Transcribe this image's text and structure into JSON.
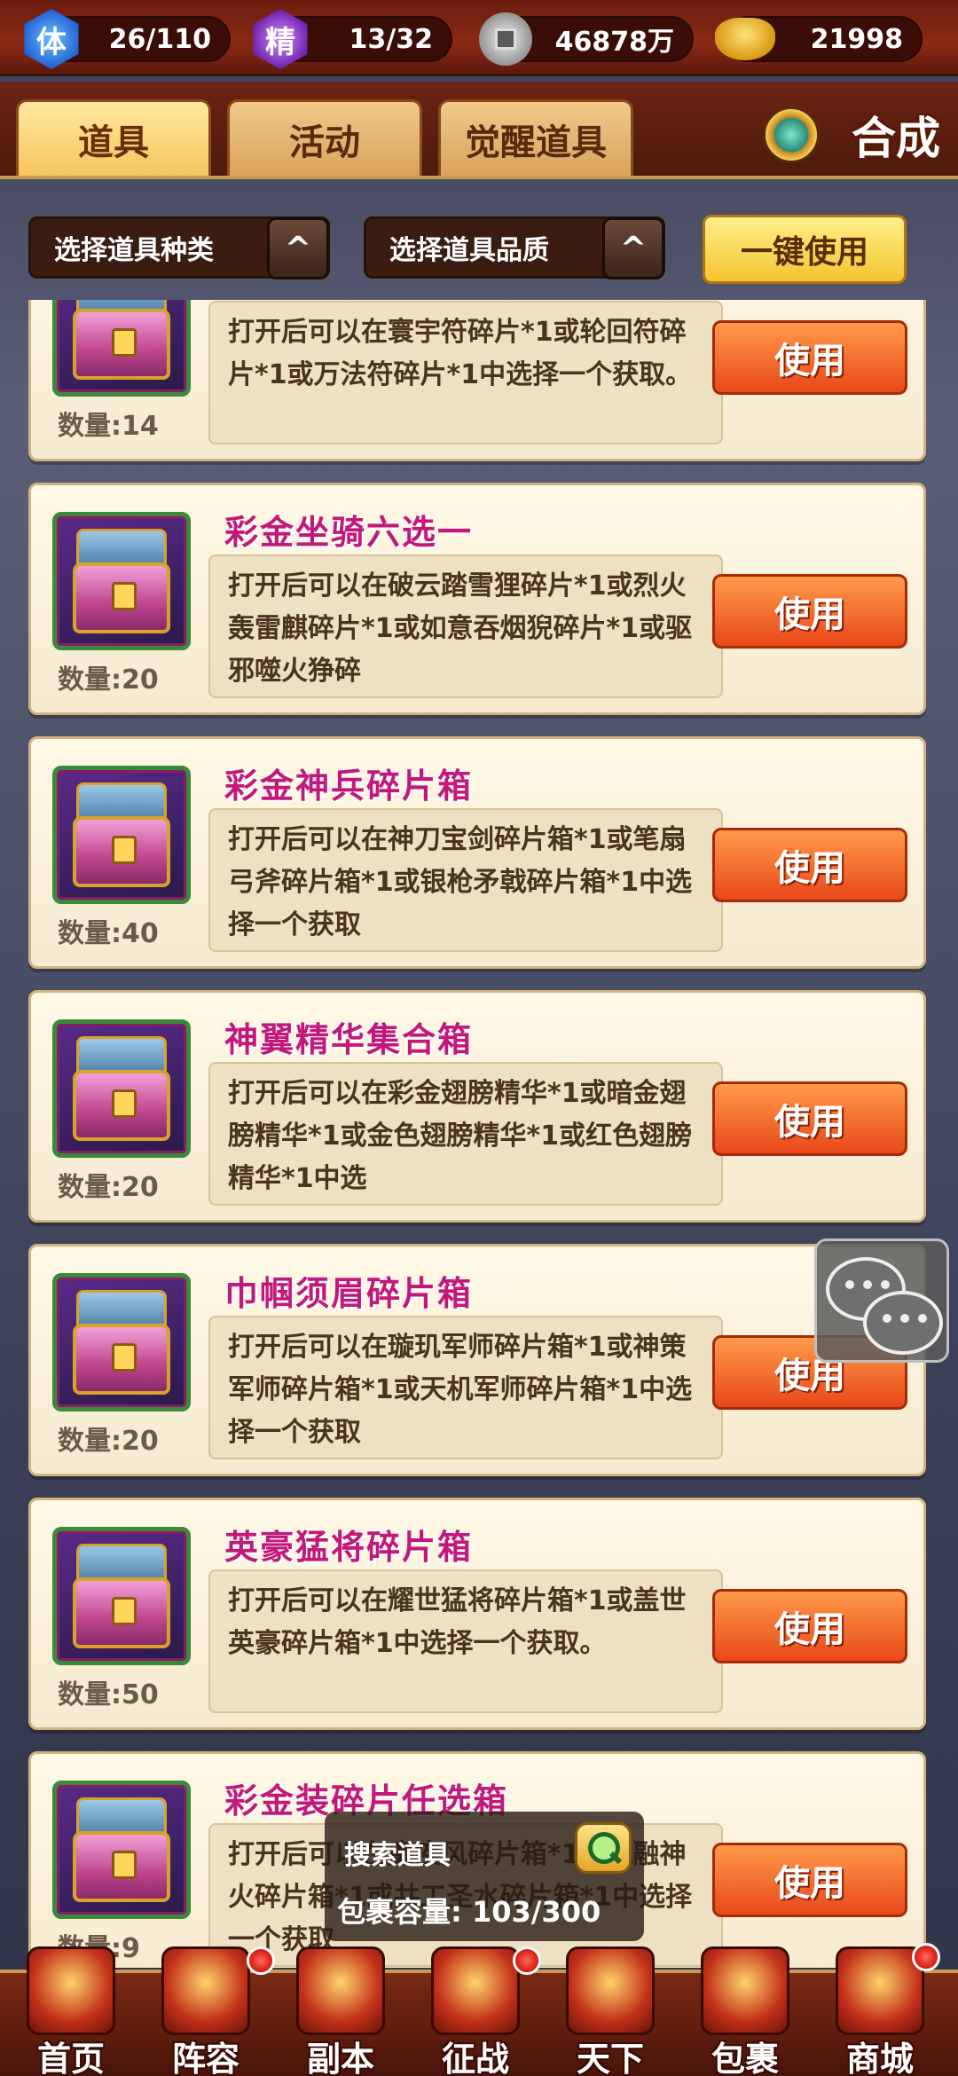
{
  "resources": {
    "stamina": {
      "icon_char": "体",
      "value": "26/110"
    },
    "spirit": {
      "icon_char": "精",
      "value": "13/32"
    },
    "coins": {
      "value": "46878万"
    },
    "ingots": {
      "value": "21998"
    }
  },
  "tabs": [
    {
      "label": "道具",
      "active": true
    },
    {
      "label": "活动",
      "active": false
    },
    {
      "label": "觉醒道具",
      "active": false
    }
  ],
  "synth_label": "合成",
  "filters": {
    "type_label": "选择道具种类",
    "quality_label": "选择道具品质",
    "chevron": "^",
    "use_all_label": "一键使用"
  },
  "items": [
    {
      "name": "",
      "desc": "打开后可以在寰宇符碎片*1或轮回符碎片*1或万法符碎片*1中选择一个获取。",
      "count": "数量:14",
      "use_label": "使用"
    },
    {
      "name": "彩金坐骑六选一",
      "desc": "打开后可以在破云踏雪狸碎片*1或烈火轰雷麒碎片*1或如意吞烟猊碎片*1或驱邪噬火狰碎",
      "count": "数量:20",
      "use_label": "使用"
    },
    {
      "name": "彩金神兵碎片箱",
      "desc": "打开后可以在神刀宝剑碎片箱*1或笔扇弓斧碎片箱*1或银枪矛戟碎片箱*1中选择一个获取",
      "count": "数量:40",
      "use_label": "使用"
    },
    {
      "name": "神翼精华集合箱",
      "desc": "打开后可以在彩金翅膀精华*1或暗金翅膀精华*1或金色翅膀精华*1或红色翅膀精华*1中选",
      "count": "数量:20",
      "use_label": "使用"
    },
    {
      "name": "巾帼须眉碎片箱",
      "desc": "打开后可以在璇玑军师碎片箱*1或神策军师碎片箱*1或天机军师碎片箱*1中选择一个获取",
      "count": "数量:20",
      "use_label": "使用"
    },
    {
      "name": "英豪猛将碎片箱",
      "desc": "打开后可以在耀世猛将碎片箱*1或盖世英豪碎片箱*1中选择一个获取。",
      "count": "数量:50",
      "use_label": "使用"
    },
    {
      "name": "彩金装碎片任选箱",
      "desc": "打开后可以在廉疾风碎片箱*1或祝融神火碎片箱*1或共工圣水碎片箱*1中选择一个获取",
      "count": "数量:9",
      "use_label": "使用"
    }
  ],
  "bag": {
    "search_label": "搜索道具",
    "capacity": "包裹容量: 103/300"
  },
  "nav": [
    {
      "label": "首页",
      "badge": false
    },
    {
      "label": "阵容",
      "badge": true
    },
    {
      "label": "副本",
      "badge": true
    },
    {
      "label": "征战",
      "badge": true
    },
    {
      "label": "天下",
      "badge": false
    },
    {
      "label": "包裹",
      "badge": true
    },
    {
      "label": "商城",
      "badge": true
    }
  ]
}
